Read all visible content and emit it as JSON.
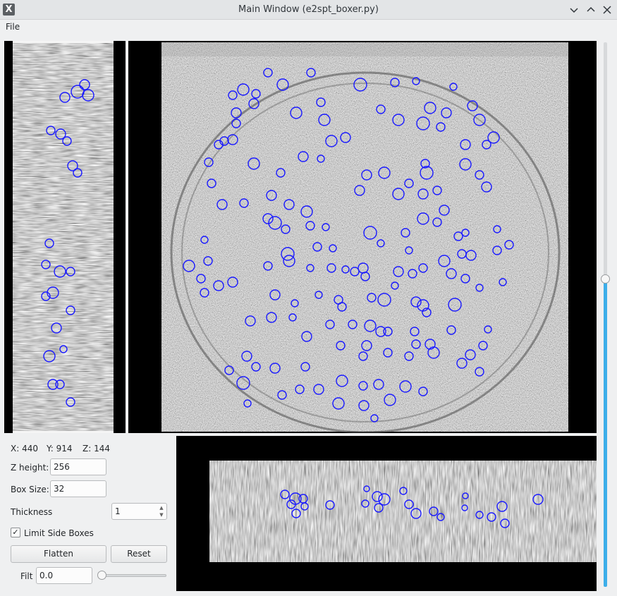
{
  "window": {
    "title": "Main Window (e2spt_boxer.py)",
    "app_icon": "X"
  },
  "menu": {
    "file": "File"
  },
  "coords": {
    "x": "X: 440",
    "y": "Y: 914",
    "z": "Z: 144"
  },
  "controls": {
    "z_height_label": "Z height:",
    "z_height_value": "256",
    "box_size_label": "Box Size:",
    "box_size_value": "32",
    "thickness_label": "Thickness",
    "thickness_value": "1",
    "limit_side_boxes_label": "Limit Side Boxes",
    "limit_side_boxes_checked": true,
    "flatten_label": "Flatten",
    "reset_label": "Reset",
    "filt_label": "Filt",
    "filt_value": "0.0",
    "filt_slider_value": 0.0,
    "z_slider_fraction": 0.56
  },
  "colors": {
    "circle": "#1a1aff",
    "accent": "#3daee9"
  },
  "icons": [
    "app-icon",
    "minimize-icon",
    "maximize-icon",
    "close-icon",
    "checkmark-icon"
  ],
  "circles": {
    "xy": [
      [
        110,
        130,
        9
      ],
      [
        125,
        135,
        8
      ],
      [
        120,
        120,
        7
      ],
      [
        86,
        190,
        7
      ],
      [
        95,
        200,
        6
      ],
      [
        72,
        185,
        6
      ],
      [
        103,
        235,
        7
      ],
      [
        110,
        245,
        6
      ],
      [
        70,
        345,
        6
      ],
      [
        65,
        375,
        6
      ],
      [
        85,
        385,
        8
      ],
      [
        100,
        385,
        6
      ],
      [
        75,
        415,
        8
      ],
      [
        65,
        420,
        6
      ],
      [
        100,
        440,
        6
      ],
      [
        80,
        465,
        7
      ],
      [
        90,
        495,
        5
      ],
      [
        70,
        505,
        8
      ],
      [
        75,
        545,
        7
      ],
      [
        85,
        545,
        6
      ],
      [
        100,
        570,
        6
      ],
      [
        92,
        138,
        7
      ]
    ],
    "main": [
      [
        380,
        103,
        6
      ],
      [
        441,
        103,
        6
      ],
      [
        401,
        120,
        8
      ],
      [
        511,
        120,
        9
      ],
      [
        345,
        127,
        8
      ],
      [
        363,
        133,
        6
      ],
      [
        330,
        135,
        6
      ],
      [
        560,
        117,
        6
      ],
      [
        590,
        115,
        5
      ],
      [
        643,
        123,
        5
      ],
      [
        670,
        150,
        7
      ],
      [
        610,
        153,
        8
      ],
      [
        633,
        160,
        7
      ],
      [
        680,
        170,
        8
      ],
      [
        700,
        195,
        8
      ],
      [
        690,
        205,
        6
      ],
      [
        660,
        205,
        7
      ],
      [
        420,
        160,
        8
      ],
      [
        460,
        170,
        8
      ],
      [
        540,
        155,
        6
      ],
      [
        565,
        170,
        8
      ],
      [
        600,
        175,
        9
      ],
      [
        625,
        180,
        6
      ],
      [
        470,
        200,
        8
      ],
      [
        490,
        195,
        7
      ],
      [
        335,
        160,
        7
      ],
      [
        335,
        175,
        6
      ],
      [
        360,
        147,
        7
      ],
      [
        455,
        145,
        6
      ],
      [
        318,
        200,
        6
      ],
      [
        330,
        198,
        7
      ],
      [
        310,
        205,
        6
      ],
      [
        296,
        230,
        6
      ],
      [
        360,
        232,
        8
      ],
      [
        430,
        222,
        7
      ],
      [
        455,
        225,
        5
      ],
      [
        398,
        245,
        6
      ],
      [
        520,
        248,
        7
      ],
      [
        545,
        245,
        8
      ],
      [
        603,
        232,
        6
      ],
      [
        605,
        245,
        9
      ],
      [
        660,
        233,
        8
      ],
      [
        680,
        248,
        6
      ],
      [
        690,
        265,
        7
      ],
      [
        510,
        270,
        7
      ],
      [
        565,
        275,
        8
      ],
      [
        600,
        275,
        7
      ],
      [
        620,
        270,
        6
      ],
      [
        580,
        260,
        6
      ],
      [
        300,
        260,
        6
      ],
      [
        315,
        290,
        7
      ],
      [
        346,
        288,
        6
      ],
      [
        385,
        277,
        7
      ],
      [
        410,
        290,
        7
      ],
      [
        435,
        300,
        8
      ],
      [
        380,
        310,
        7
      ],
      [
        390,
        316,
        9
      ],
      [
        405,
        325,
        6
      ],
      [
        440,
        320,
        6
      ],
      [
        462,
        322,
        5
      ],
      [
        525,
        330,
        9
      ],
      [
        540,
        345,
        5
      ],
      [
        575,
        330,
        6
      ],
      [
        600,
        310,
        8
      ],
      [
        620,
        315,
        6
      ],
      [
        630,
        298,
        7
      ],
      [
        650,
        335,
        6
      ],
      [
        660,
        330,
        5
      ],
      [
        705,
        325,
        5
      ],
      [
        705,
        355,
        6
      ],
      [
        722,
        347,
        6
      ],
      [
        655,
        360,
        6
      ],
      [
        668,
        362,
        7
      ],
      [
        580,
        355,
        5
      ],
      [
        450,
        350,
        6
      ],
      [
        472,
        352,
        5
      ],
      [
        408,
        360,
        9
      ],
      [
        410,
        370,
        8
      ],
      [
        268,
        377,
        8
      ],
      [
        295,
        370,
        6
      ],
      [
        290,
        340,
        5
      ],
      [
        285,
        395,
        6
      ],
      [
        310,
        405,
        7
      ],
      [
        330,
        400,
        7
      ],
      [
        290,
        415,
        6
      ],
      [
        380,
        377,
        6
      ],
      [
        440,
        380,
        5
      ],
      [
        470,
        380,
        6
      ],
      [
        490,
        382,
        5
      ],
      [
        503,
        385,
        6
      ],
      [
        515,
        380,
        7
      ],
      [
        518,
        392,
        6
      ],
      [
        565,
        385,
        7
      ],
      [
        585,
        388,
        6
      ],
      [
        600,
        380,
        6
      ],
      [
        630,
        370,
        8
      ],
      [
        640,
        388,
        7
      ],
      [
        660,
        395,
        6
      ],
      [
        713,
        400,
        5
      ],
      [
        390,
        418,
        7
      ],
      [
        418,
        430,
        5
      ],
      [
        452,
        418,
        5
      ],
      [
        480,
        425,
        6
      ],
      [
        485,
        435,
        6
      ],
      [
        527,
        422,
        6
      ],
      [
        545,
        425,
        9
      ],
      [
        560,
        405,
        5
      ],
      [
        590,
        428,
        7
      ],
      [
        600,
        433,
        8
      ],
      [
        605,
        443,
        6
      ],
      [
        645,
        432,
        9
      ],
      [
        680,
        408,
        5
      ],
      [
        355,
        455,
        7
      ],
      [
        385,
        450,
        7
      ],
      [
        415,
        450,
        5
      ],
      [
        435,
        477,
        7
      ],
      [
        468,
        460,
        6
      ],
      [
        500,
        460,
        6
      ],
      [
        525,
        462,
        8
      ],
      [
        540,
        470,
        7
      ],
      [
        550,
        470,
        6
      ],
      [
        588,
        470,
        6
      ],
      [
        610,
        488,
        7
      ],
      [
        590,
        488,
        6
      ],
      [
        615,
        500,
        8
      ],
      [
        640,
        468,
        6
      ],
      [
        667,
        503,
        7
      ],
      [
        692,
        467,
        5
      ],
      [
        685,
        490,
        6
      ],
      [
        350,
        505,
        7
      ],
      [
        363,
        520,
        6
      ],
      [
        325,
        525,
        6
      ],
      [
        345,
        543,
        9
      ],
      [
        390,
        522,
        7
      ],
      [
        433,
        520,
        6
      ],
      [
        483,
        490,
        6
      ],
      [
        520,
        490,
        7
      ],
      [
        515,
        505,
        6
      ],
      [
        550,
        500,
        6
      ],
      [
        580,
        505,
        6
      ],
      [
        655,
        515,
        7
      ],
      [
        680,
        527,
        6
      ],
      [
        400,
        560,
        6
      ],
      [
        425,
        552,
        6
      ],
      [
        452,
        552,
        7
      ],
      [
        485,
        540,
        8
      ],
      [
        515,
        547,
        6
      ],
      [
        537,
        545,
        7
      ],
      [
        575,
        548,
        8
      ],
      [
        600,
        555,
        6
      ],
      [
        553,
        567,
        8
      ],
      [
        480,
        572,
        8
      ],
      [
        516,
        575,
        7
      ],
      [
        351,
        572,
        5
      ],
      [
        531,
        593,
        5
      ]
    ],
    "xz": [
      [
        404,
        701,
        6
      ],
      [
        413,
        715,
        6
      ],
      [
        419,
        707,
        8
      ],
      [
        430,
        707,
        6
      ],
      [
        432,
        718,
        5
      ],
      [
        420,
        728,
        6
      ],
      [
        468,
        716,
        6
      ],
      [
        520,
        693,
        4
      ],
      [
        518,
        714,
        5
      ],
      [
        535,
        704,
        7
      ],
      [
        545,
        708,
        8
      ],
      [
        537,
        720,
        6
      ],
      [
        572,
        696,
        5
      ],
      [
        580,
        715,
        6
      ],
      [
        590,
        728,
        7
      ],
      [
        615,
        725,
        6
      ],
      [
        625,
        733,
        5
      ],
      [
        660,
        703,
        4
      ],
      [
        659,
        720,
        4
      ],
      [
        680,
        730,
        5
      ],
      [
        697,
        733,
        6
      ],
      [
        712,
        718,
        7
      ],
      [
        716,
        742,
        6
      ],
      [
        763,
        708,
        7
      ]
    ]
  }
}
